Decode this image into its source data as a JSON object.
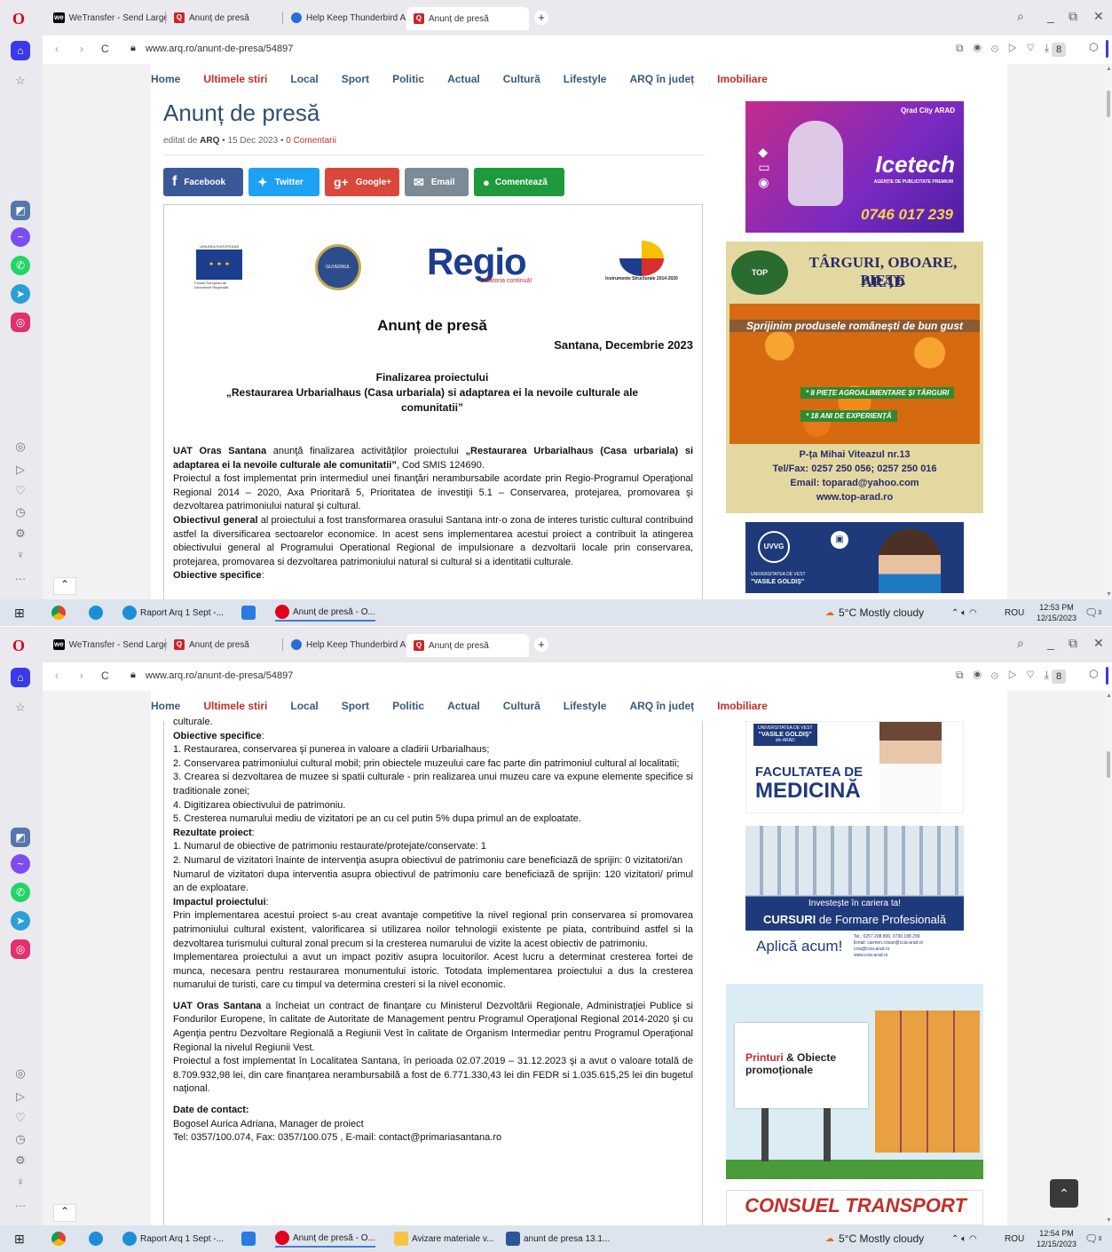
{
  "browser": {
    "tabs": [
      {
        "label": "WeTransfer - Send Large F",
        "icon": "wetransfer-icon",
        "fav": "we"
      },
      {
        "label": "Anunț de presă",
        "icon": "arq-q-icon",
        "fav": "Q"
      },
      {
        "label": "Help Keep Thunderbird A",
        "icon": "thunderbird-icon",
        "fav": ""
      },
      {
        "label": "Anunț de presă",
        "icon": "arq-q-icon",
        "fav": "Q"
      }
    ],
    "new_tab": "+",
    "url": "www.arq.ro/anunt-de-presa/54897",
    "window_controls": [
      "⌕",
      "_",
      "⧉",
      "✕"
    ],
    "toolbar_badge": "8"
  },
  "site": {
    "nav": [
      "Home",
      "Ultimele stiri",
      "Local",
      "Sport",
      "Politic",
      "Actual",
      "Cultură",
      "Lifestyle",
      "ARQ în județ",
      "Imobiliare"
    ],
    "title": "Anunț de presă",
    "byline": {
      "prefix": "editat de",
      "author": "ARQ",
      "date": "15 Dec 2023",
      "comments": "0 Comentarii"
    },
    "share": [
      {
        "label": "Facebook",
        "icon": "f",
        "color": "#3b5998"
      },
      {
        "label": "Twitter",
        "icon": "✦",
        "color": "#1da1f2"
      },
      {
        "label": "Google+",
        "icon": "g+",
        "color": "#d9483b"
      },
      {
        "label": "Email",
        "icon": "✉",
        "color": "#7b8a95"
      },
      {
        "label": "Comentează",
        "icon": "●",
        "color": "#1e9a3c"
      }
    ]
  },
  "doc": {
    "logo_eu_lines": [
      "UNIUNEA EUROPEANĂ",
      "Fondul European de Dezvoltare Regională"
    ],
    "logo_gov": "GUVERNUL ROMÂNIEI",
    "logo_regio": "Regio",
    "logo_regio_sub": "Călătoria continuă!",
    "logo_is": "Instrumente Structurale 2014-2020",
    "heading": "Anunț de presă",
    "place_date": "Santana, Decembrie 2023",
    "sub1": "Finalizarea proiectului",
    "sub2": "„Restaurarea Urbarialhaus (Casa urbariala) si adaptarea ei la nevoile culturale ale comunitatii”",
    "p1_bold": "UAT Oras Santana",
    "p1_a": " anunţă finalizarea activităţilor proiectului ",
    "p1_b": "„Restaurarea Urbarialhaus (Casa urbariala) si adaptarea ei la nevoile culturale ale comunitatii”",
    "p1_c": ", Cod SMIS 124690.",
    "p2": "Proiectul a fost implementat prin intermediul unei finanţări nerambursabile acordate prin Regio-Programul Operaţional Regional 2014 – 2020, Axa Prioritară 5, Prioritatea de investiţii 5.1  – Conservarea, protejarea, promovarea şi dezvoltarea patrimoniului natural şi cultural.",
    "p3_bold": "Obiectivul general",
    "p3": " al proiectului a fost  transformarea orasului Santana intr-o zona de interes turistic cultural contribuind astfel la diversificarea sectoarelor economice. In acest sens implementarea acestui proiect a contribuit la atingerea obiectivului general al Programului Operational Regional de impulsionare a dezvoltarii locale prin conservarea, protejarea, promovarea si dezvoltarea patrimoniului natural si cultural si a identitatii culturale.",
    "obj_title": "Obiective specifice",
    "obj": [
      "1. Restaurarea, conservarea şi punerea in valoare a cladirii Urbarialhaus;",
      "2. Conservarea patrimoniului cultural mobil; prin obiectele muzeului care fac parte din patrimoniul cultural al localitatii;",
      "3. Crearea si dezvoltarea de muzee si spatii culturale - prin realizarea unui muzeu care va expune elemente specifice si traditionale zonei;",
      "4. Digitizarea obiectivului de patrimoniu.",
      "5. Cresterea numarului mediu de vizitatori pe an cu cel putin 5% dupa primul an de exploatate."
    ],
    "res_title": "Rezultate proiect",
    "res": [
      "1. Numarul de obiective de patrimoniu restaurate/protejate/conservate: 1",
      "2. Numarul de vizitatori înainte de intervenţia asupra obiectivul de patrimoniu care beneficiază de sprijin: 0 vizitatori/an",
      "Numarul de vizitatori dupa interventia asupra obiectivul de patrimoniu care beneficiază de sprijin: 120 vizitatori/ primul an de exploatare."
    ],
    "imp_title": "Impactul proiectului",
    "imp1": " Prin implementarea acestui proiect s-au creat avantaje competitive la nivel regional prin conservarea si promovarea patrimoniului cultural existent, valorificarea si utilizarea noilor tehnologii existente pe piata, contribuind astfel si la dezvoltarea turismului cultural zonal precum si la cresterea numarului de vizite la acest obiectiv de patrimoniu.",
    "imp2": "Implementarea proiectului a avut un impact pozitiv asupra locuitorilor. Acest lucru a determinat cresterea fortei de munca, necesara pentru restaurarea monumentului istoric. Totodata implementarea proiectului a dus la cresterea numarului de turisti, care cu timpul va determina cresteri si la nivel economic.",
    "c1_bold": "UAT Oras Santana",
    "c1": " a încheiat un contract de finanţare cu Ministerul Dezvoltării Regionale, Administraţiei Publice si Fondurilor Europene, în calitate de Autoritate de Management pentru Programul Operaţional Regional 2014-2020 şi cu Agenţia pentru Dezvoltare Regională a Regiunii Vest în calitate de Organism Intermediar pentru Programul Operaţional Regional la nivelul Regiunii Vest.",
    "c2": "Proiectul a fost implementat în Localitatea Santana, în perioada 02.07.2019 – 31.12.2023 şi a avut o valoare totală de 8.709.932,98 lei, din care finanţarea nerambursabilă a fost de 6.771.330,43 lei din FEDR si 1.035.615,25 lei din bugetul naţional.",
    "contact_title": "Date de contact:",
    "contact1": "Bogosel Aurica Adriana, Manager de proiect",
    "contact2": "Tel: 0357/100.074, Fax: 0357/100.075 , E-mail: contact@primariasantana.ro",
    "cut_line": "culturale."
  },
  "ads": {
    "icetech": {
      "brand": "Icetech",
      "tag": "AGENȚIE DE PUBLICITATE PREMIUM",
      "phone": "0746 017 239",
      "logos": "Qrad City  ARAD"
    },
    "top": {
      "title": "TÂRGURI, OBOARE, PIEȚE",
      "city": "ARAD",
      "slogan": "Sprijinim produsele românești de bun gust",
      "b1": "* 8 PIEȚE AGROALIMENTARE ȘI TÂRGURI",
      "b2": "* 18 ANI DE EXPERIENȚĂ",
      "addr": "P-ța Mihai Viteazul nr.13",
      "tel": "Tel/Fax: 0257 250 056; 0257 250 016",
      "email": "Email: toparad@yahoo.com",
      "web": "www.top-arad.ro",
      "logo": "TOP"
    },
    "uvvg": {
      "uni": "UNIVERSITATEA DE VEST",
      "name": "\"VASILE GOLDIȘ\"",
      "city": "din ARAD",
      "fac1": "FACULTATEA DE",
      "fac2": "MEDICINĂ"
    },
    "ccia": {
      "l1": "Investește în cariera ta!",
      "l2a": "CURSURI",
      "l2b": " de Formare Profesională",
      "l3": "Aplică acum!",
      "tel": "Tel.: 0257.208 800, 0730.188 299",
      "email": "Email: carmen.crisan@ccia-arad.ro",
      "email2": "ccia@ccia-arad.ro",
      "web": "www.ccia-arad.ro"
    },
    "printuri": {
      "l1a": "Printuri",
      "l1b": " & Obiecte",
      "l2": "promoționale"
    },
    "consuel": "CONSUEL TRANSPORT"
  },
  "taskbar1": {
    "items": [
      "Raport Arq 1 Sept -...",
      "Anunț de presă - O..."
    ],
    "weather": "5°C  Mostly cloudy",
    "lang": "ROU",
    "time": "12:53 PM",
    "date": "12/15/2023",
    "notif": "3"
  },
  "taskbar2": {
    "items": [
      "Raport Arq 1 Sept -...",
      "Anunț de presă - O...",
      "Avizare materiale v...",
      "anunt de presa 13.1..."
    ],
    "weather": "5°C  Mostly cloudy",
    "lang": "ROU",
    "time": "12:54 PM",
    "date": "12/15/2023",
    "notif": "3"
  }
}
